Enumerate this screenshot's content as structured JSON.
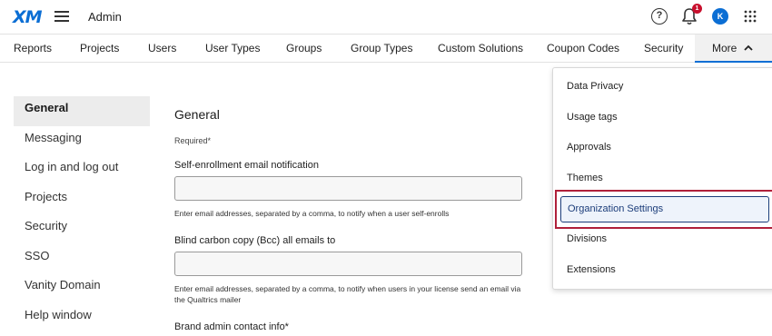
{
  "topbar": {
    "logo": "XM",
    "title": "Admin",
    "help_glyph": "?",
    "notification_count": "1",
    "avatar_initial": "K"
  },
  "nav": {
    "tabs": [
      {
        "label": "Reports"
      },
      {
        "label": "Projects"
      },
      {
        "label": "Users"
      },
      {
        "label": "User Types"
      },
      {
        "label": "Groups"
      },
      {
        "label": "Group Types"
      },
      {
        "label": "Custom Solutions"
      },
      {
        "label": "Coupon Codes"
      },
      {
        "label": "Security"
      }
    ],
    "more_label": "More",
    "more_chevron": "⌃"
  },
  "sidebar": {
    "items": [
      {
        "label": "General"
      },
      {
        "label": "Messaging"
      },
      {
        "label": "Log in and log out"
      },
      {
        "label": "Projects"
      },
      {
        "label": "Security"
      },
      {
        "label": "SSO"
      },
      {
        "label": "Vanity Domain"
      },
      {
        "label": "Help window"
      }
    ]
  },
  "form": {
    "title": "General",
    "required_note": "Required*",
    "fields": [
      {
        "label": "Self-enrollment email notification",
        "value": "",
        "help": "Enter email addresses, separated by a comma, to notify when a user self-enrolls"
      },
      {
        "label": "Blind carbon copy (Bcc) all emails to",
        "value": "",
        "help": "Enter email addresses, separated by a comma, to notify when users in your license send an email via the Qualtrics mailer"
      }
    ],
    "contact_label": "Brand admin contact info*"
  },
  "more_menu": {
    "items": [
      {
        "label": "Data Privacy"
      },
      {
        "label": "Usage tags"
      },
      {
        "label": "Approvals"
      },
      {
        "label": "Themes"
      },
      {
        "label": "Organization Settings"
      },
      {
        "label": "Divisions"
      },
      {
        "label": "Extensions"
      }
    ],
    "selected_index": 4
  },
  "colors": {
    "brand_blue": "#0b6ed4",
    "highlight_red": "#b0203a",
    "badge_red": "#c8102e"
  }
}
